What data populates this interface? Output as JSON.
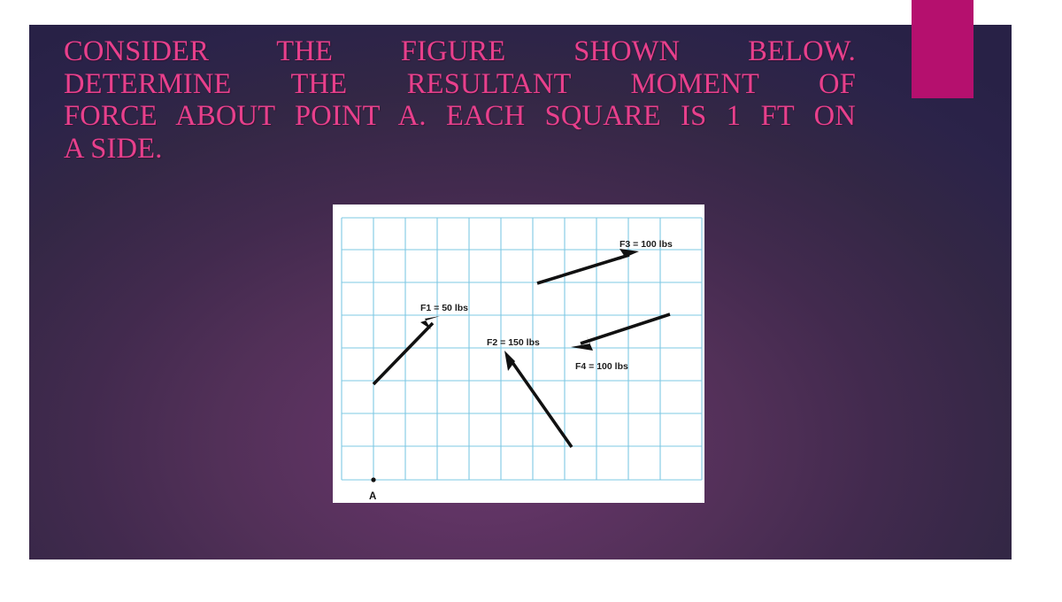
{
  "slide": {
    "background_center_color": "#5E3362",
    "background_edge_color": "#2B2349",
    "accent_rect_color": "#B5106E",
    "title_color": "#E8408C"
  },
  "title": {
    "full_text": "CONSIDER THE FIGURE SHOWN BELOW. DETERMINE THE RESULTANT MOMENT OF FORCE ABOUT POINT A. EACH SQUARE IS 1 FT ON A SIDE.",
    "lines": [
      "CONSIDER THE FIGURE SHOWN BELOW.",
      "DETERMINE THE RESULTANT MOMENT OF",
      "FORCE ABOUT POINT A. EACH SQUARE IS 1 FT ON",
      "A SIDE."
    ]
  },
  "figure": {
    "grid": {
      "cell_size_label": "1 ft",
      "columns": 11,
      "rows": 8,
      "line_color": "#7EC8E3",
      "background_color": "#FFFFFF"
    },
    "origin_point": {
      "label": "A",
      "grid_x": 1,
      "grid_y": 0
    },
    "forces": [
      {
        "name": "F1",
        "label": "F1 = 50 lbs",
        "magnitude": 50,
        "unit": "lbs",
        "tail_grid": [
          1,
          3
        ],
        "head_grid": [
          3.1,
          5.15
        ],
        "direction": "up-right"
      },
      {
        "name": "F2",
        "label": "F2 = 150 lbs",
        "magnitude": 150,
        "unit": "lbs",
        "tail_grid": [
          7.2,
          1.05
        ],
        "head_grid": [
          5.1,
          4.05
        ],
        "direction": "up-left"
      },
      {
        "name": "F3",
        "label": "F3 = 100 lbs",
        "magnitude": 100,
        "unit": "lbs",
        "tail_grid": [
          6.15,
          6.15
        ],
        "head_grid": [
          9.35,
          7.15
        ],
        "direction": "up-right"
      },
      {
        "name": "F4",
        "label": "F4 = 100 lbs",
        "magnitude": 100,
        "unit": "lbs",
        "tail_grid": [
          10.3,
          5.2
        ],
        "head_grid": [
          7.2,
          4.15
        ],
        "direction": "down-left"
      }
    ]
  }
}
